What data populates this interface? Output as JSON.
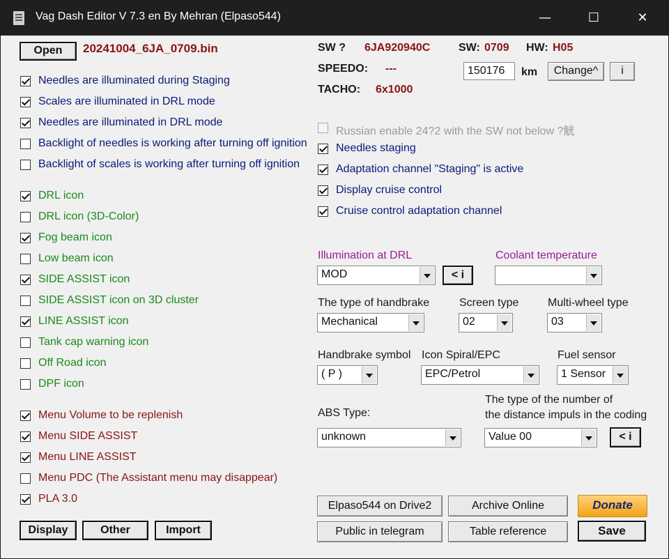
{
  "window": {
    "title": "Vag Dash Editor V 7.3 en By Mehran (Elpaso544)",
    "minimize": "—",
    "maximize": "☐",
    "close": "✕"
  },
  "file": {
    "open_label": "Open",
    "filename": "20241004_6JA_0709.bin"
  },
  "info": {
    "sw_q_label": "SW ?",
    "sw_q_value": "6JA920940C",
    "sw_label": "SW:",
    "sw_value": "0709",
    "hw_label": "HW:",
    "hw_value": "H05",
    "speedo_label": "SPEEDO:",
    "speedo_value": "---",
    "tacho_label": "TACHO:",
    "tacho_value": "6x1000",
    "km_value": "150176",
    "km_label": "km",
    "change_label": "Change^",
    "info_label": "i"
  },
  "left_group1": [
    {
      "label": "Needles are illuminated during Staging",
      "checked": true
    },
    {
      "label": "Scales are illuminated in DRL mode",
      "checked": true
    },
    {
      "label": "Needles are illuminated in DRL mode",
      "checked": true
    },
    {
      "label": "Backlight of needles is working after turning off ignition",
      "checked": false
    },
    {
      "label": "Backlight of scales is working after turning off ignition",
      "checked": false
    }
  ],
  "left_group2": [
    {
      "label": "DRL icon",
      "checked": true
    },
    {
      "label": "DRL icon (3D-Color)",
      "checked": false
    },
    {
      "label": "Fog beam icon",
      "checked": true
    },
    {
      "label": "Low beam icon",
      "checked": false
    },
    {
      "label": "SIDE ASSIST icon",
      "checked": true
    },
    {
      "label": "SIDE ASSIST icon on 3D cluster",
      "checked": false
    },
    {
      "label": "LINE ASSIST icon",
      "checked": true
    },
    {
      "label": "Tank cap warning icon",
      "checked": false
    },
    {
      "label": "Off Road icon",
      "checked": false
    },
    {
      "label": "DPF icon",
      "checked": false
    }
  ],
  "left_group3": [
    {
      "label": "Menu Volume to be replenish",
      "checked": true
    },
    {
      "label": "Menu SIDE ASSIST",
      "checked": true
    },
    {
      "label": "Menu LINE ASSIST",
      "checked": true
    },
    {
      "label": "Menu PDC (The Assistant menu may disappear)",
      "checked": false
    },
    {
      "label": "PLA 3.0",
      "checked": true
    }
  ],
  "right_checks": [
    {
      "label": "Russian enable  24?2 with the SW not below ?觥",
      "checked": false,
      "disabled": true
    },
    {
      "label": "Needles staging",
      "checked": true
    },
    {
      "label": "Adaptation channel \"Staging\" is active",
      "checked": true
    },
    {
      "label": "Display cruise control",
      "checked": true
    },
    {
      "label": "Cruise control adaptation channel",
      "checked": true
    }
  ],
  "selects": {
    "illum_label": "Illumination at DRL",
    "illum_value": "MOD",
    "illum_btn": "< i",
    "coolant_label": "Coolant temperature",
    "coolant_value": "",
    "handbrake_label": "The type of handbrake",
    "handbrake_value": "Mechanical",
    "screen_label": "Screen type",
    "screen_value": "02",
    "multiwheel_label": "Multi-wheel type",
    "multiwheel_value": "03",
    "hbsym_label": "Handbrake symbol",
    "hbsym_value": "( P )",
    "spiral_label": "Icon Spiral/EPC",
    "spiral_value": "EPC/Petrol",
    "fuel_label": "Fuel sensor",
    "fuel_value": "1 Sensor",
    "abs_label": "ABS Type:",
    "abs_value": "unknown",
    "dist_label1": "The type of the number of",
    "dist_label2": "the distance impuls in the coding",
    "dist_value": "Value 00",
    "dist_btn": "< i"
  },
  "bottom": {
    "display_label": "Display",
    "other_label": "Other",
    "import_label": "Import",
    "drive_label": "Elpaso544 on Drive2",
    "archive_label": "Archive Online",
    "donate_label": "Donate",
    "telegram_label": "Public in telegram",
    "table_label": "Table reference",
    "save_label": "Save"
  }
}
